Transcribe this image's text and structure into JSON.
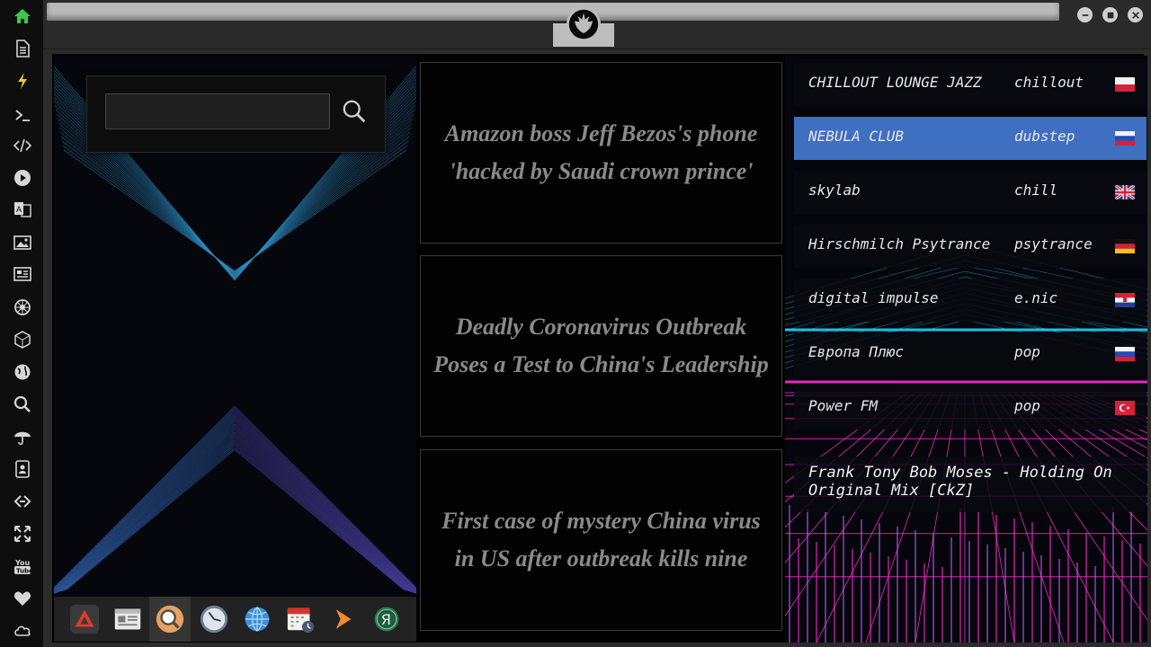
{
  "sidebar": {
    "icons": [
      "home-icon",
      "document-icon",
      "lightning-icon",
      "terminal-icon",
      "code-icon",
      "play-icon",
      "translate-icon",
      "image-icon",
      "newspaper-icon",
      "rebel-icon",
      "hexagon-icon",
      "globe-icon",
      "search-icon",
      "umbrella-icon",
      "contacts-icon",
      "link-icon",
      "expand-icon",
      "youtube-icon",
      "heart-icon",
      "cloud-icon"
    ]
  },
  "search": {
    "value": "",
    "placeholder": ""
  },
  "dock": {
    "items": [
      "anydesk-icon",
      "news-reader-icon",
      "magnifier-icon",
      "clock-icon",
      "globe-icon",
      "calendar-icon",
      "forward-icon",
      "yandex-icon"
    ]
  },
  "news": [
    {
      "headline": "Amazon boss Jeff Bezos's phone 'hacked by Saudi crown prince'"
    },
    {
      "headline": "Deadly Coronavirus Outbreak Poses a Test to China's Leadership"
    },
    {
      "headline": "First case of mystery China virus in US after outbreak kills nine"
    }
  ],
  "radio": {
    "stations": [
      {
        "name": "CHILLOUT LOUNGE JAZZ",
        "genre": "chillout",
        "flag": "poland"
      },
      {
        "name": "NEBULA CLUB",
        "genre": "dubstep",
        "flag": "russia"
      },
      {
        "name": "skylab",
        "genre": "chill",
        "flag": "united-kingdom"
      },
      {
        "name": "Hirschmilch Psytrance",
        "genre": "psytrance",
        "flag": "germany"
      },
      {
        "name": "digital impulse",
        "genre": "e.nic",
        "flag": "croatia"
      },
      {
        "name": "Европа Плюс",
        "genre": "pop",
        "flag": "russia"
      },
      {
        "name": "Power FM",
        "genre": "pop",
        "flag": "turkey"
      }
    ],
    "active_index": 1,
    "now_playing": "Frank Tony Bob Moses - Holding On Original Mix [CkZ]"
  },
  "colors": {
    "active_station": "#3f6fc0",
    "headline_text": "#8a8a8a",
    "synth_cyan": "#19d6ff",
    "synth_magenta": "#ff2bd6"
  }
}
